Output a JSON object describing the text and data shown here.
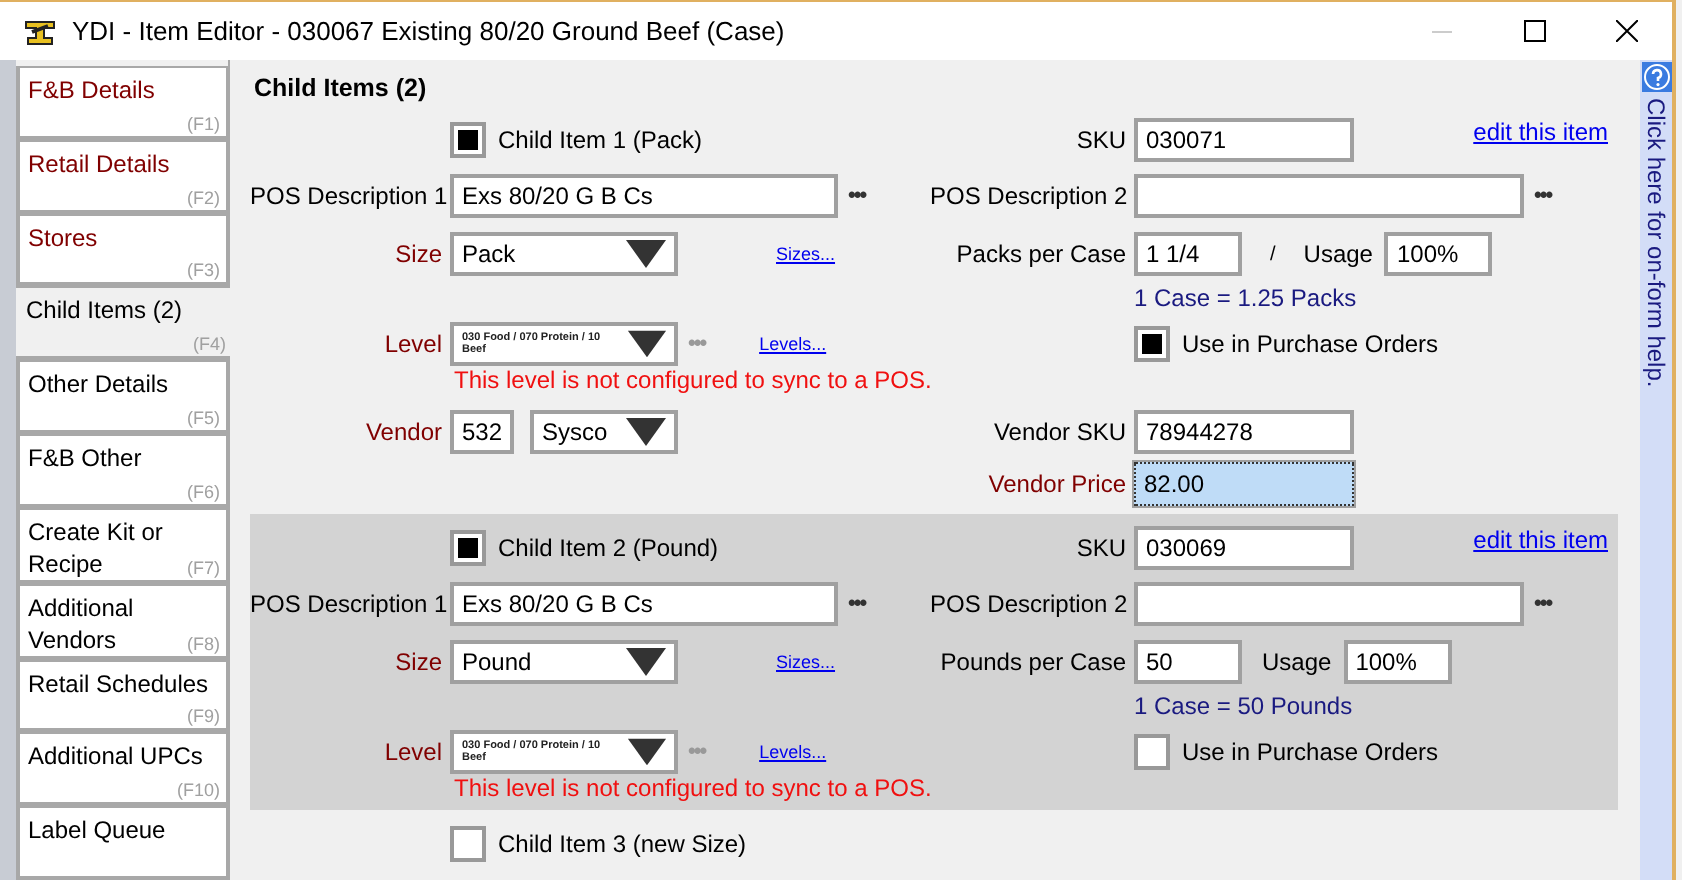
{
  "window": {
    "title": "YDI - Item Editor - 030067 Existing 80/20 Ground Beef (Case)"
  },
  "tabs": [
    {
      "label": "F&B Details",
      "shortcut": "(F1)",
      "color": "#800000",
      "selected": false
    },
    {
      "label": "Retail Details",
      "shortcut": "(F2)",
      "color": "#800000",
      "selected": false
    },
    {
      "label": "Stores",
      "shortcut": "(F3)",
      "color": "#800000",
      "selected": false
    },
    {
      "label": "Child Items (2)",
      "shortcut": "(F4)",
      "color": "#000000",
      "selected": true
    },
    {
      "label": "Other Details",
      "shortcut": "(F5)",
      "color": "#000000",
      "selected": false
    },
    {
      "label": "F&B Other",
      "shortcut": "(F6)",
      "color": "#000000",
      "selected": false
    },
    {
      "label": "Create Kit or Recipe",
      "shortcut": "(F7)",
      "color": "#000000",
      "selected": false
    },
    {
      "label": "Additional Vendors",
      "shortcut": "(F8)",
      "color": "#000000",
      "selected": false
    },
    {
      "label": "Retail Schedules",
      "shortcut": "(F9)",
      "color": "#000000",
      "selected": false
    },
    {
      "label": "Additional UPCs",
      "shortcut": "(F10)",
      "color": "#000000",
      "selected": false
    },
    {
      "label": "Label Queue",
      "color": "#000000",
      "selected": false
    }
  ],
  "section_title": "Child Items (2)",
  "child_items": [
    {
      "checked": true,
      "title": "Child Item 1 (Pack)",
      "shaded": false,
      "sku": {
        "label": "SKU",
        "value": "030071"
      },
      "edit_link": "edit this item",
      "pos1": {
        "label": "POS Description 1",
        "value": "Exs 80/20 G B Cs",
        "more": "•••"
      },
      "pos2": {
        "label": "POS Description 2",
        "more": "•••"
      },
      "size": {
        "label": "Size",
        "required": true,
        "value": "Pack",
        "link": "Sizes..."
      },
      "per_case": {
        "label": "Packs per Case",
        "value": "1 1/4",
        "slash": "/"
      },
      "usage": {
        "label": "Usage",
        "value": "100%"
      },
      "conversion": "1 Case = 1.25 Packs",
      "level": {
        "label": "Level",
        "required": true,
        "value": "030 Food / 070 Protein / 10 Beef",
        "more": "•••",
        "link": "Levels..."
      },
      "purchase_orders": {
        "label": "Use in Purchase Orders",
        "checked": true
      },
      "warning": "This level is not configured to sync to a POS.",
      "vendor": {
        "label": "Vendor",
        "required": true,
        "code": "532",
        "name": "Sysco"
      },
      "vendor_sku": {
        "label": "Vendor SKU",
        "value": "78944278"
      },
      "vendor_price": {
        "label": "Vendor Price",
        "required": true,
        "value": "82.00",
        "focused": true
      }
    },
    {
      "checked": true,
      "title": "Child Item 2 (Pound)",
      "shaded": true,
      "sku": {
        "label": "SKU",
        "value": "030069"
      },
      "edit_link": "edit this item",
      "pos1": {
        "label": "POS Description 1",
        "value": "Exs 80/20 G B Cs",
        "more": "•••"
      },
      "pos2": {
        "label": "POS Description 2",
        "more": "•••"
      },
      "size": {
        "label": "Size",
        "required": true,
        "value": "Pound",
        "link": "Sizes..."
      },
      "per_case": {
        "label": "Pounds per Case",
        "value": "50"
      },
      "usage": {
        "label": "Usage",
        "value": "100%"
      },
      "conversion": "1 Case = 50 Pounds",
      "level": {
        "label": "Level",
        "required": true,
        "value": "030 Food / 070 Protein / 10 Beef",
        "more": "•••",
        "link": "Levels..."
      },
      "purchase_orders": {
        "label": "Use in Purchase Orders",
        "checked": false
      },
      "warning": "This level is not configured to sync to a POS."
    },
    {
      "checked": false,
      "title": "Child Item 3 (new Size)",
      "shaded": false
    }
  ],
  "help": {
    "label": "Click here for on-form help."
  }
}
